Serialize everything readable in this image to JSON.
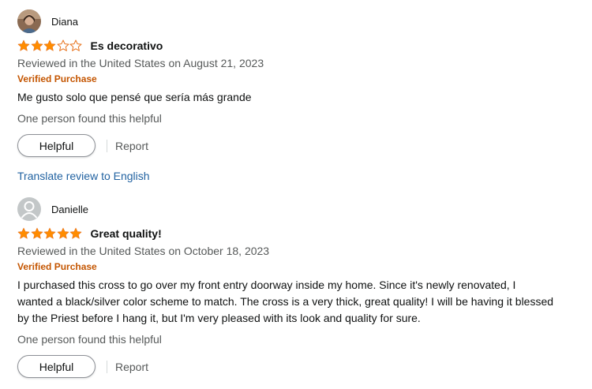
{
  "reviews": [
    {
      "profile_name": "Diana",
      "rating": 3,
      "rating_max": 5,
      "title": "Es decorativo",
      "date": "Reviewed in the United States on August 21, 2023",
      "verified": "Verified Purchase",
      "body": "Me gusto solo que pensé que sería más grande",
      "helpful_count": "One person found this helpful",
      "helpful_button": "Helpful",
      "report_link": "Report",
      "translate_link": "Translate review to English"
    },
    {
      "profile_name": "Danielle",
      "rating": 5,
      "rating_max": 5,
      "title": "Great quality!",
      "date": "Reviewed in the United States on October 18, 2023",
      "verified": "Verified Purchase",
      "body": "I purchased this cross to go over my front entry doorway inside my home. Since it's newly renovated, I wanted a black/silver color scheme to match. The cross is a very thick, great quality! I will be having it blessed by the Priest before I hang it, but I'm very pleased with its look and quality for sure.",
      "helpful_count": "One person found this helpful",
      "helpful_button": "Helpful",
      "report_link": "Report"
    }
  ],
  "colors": {
    "star_fill": "#ff8c00",
    "star_empty_stroke": "#e7711b",
    "verified": "#c45500",
    "link": "#2162a1",
    "muted": "#565959"
  },
  "icons": {
    "avatar_1": "user-photo-avatar",
    "avatar_2": "default-user-avatar-icon",
    "star_full": "star-filled-icon",
    "star_empty": "star-empty-icon"
  }
}
